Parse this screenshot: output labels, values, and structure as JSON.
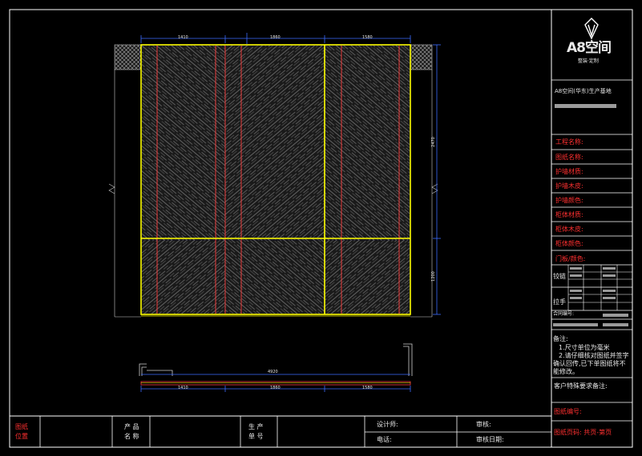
{
  "brand": {
    "name": "A8空间",
    "tagline": "整装·定制"
  },
  "sheet_title": "A8空间(华东)生产基地",
  "fields": [
    "工程名称:",
    "图纸名称:",
    "护墙材质:",
    "护墙木皮:",
    "护墙颜色:",
    "柜体材质:",
    "柜体木皮:",
    "柜体颜色:",
    "门板/颜色:"
  ],
  "hardware": {
    "hinge": "铰链",
    "handle": "拉手"
  },
  "contract_label": "合同编号:",
  "notes": {
    "title": "备注:",
    "line1": "1.尺寸单位为毫米",
    "line2": "2.请仔细核对图纸并签字",
    "line3": "确认回传,已下单图纸将不",
    "line4": "能修改。"
  },
  "customer_note": "客户特殊要求备注:",
  "drawing_no": "图纸编号:",
  "page_no": "图纸页码: 共页-第页",
  "bottom": {
    "position_l1": "图纸",
    "position_l2": "位置",
    "product_l1": "产 品",
    "product_l2": "名 称",
    "order_l1": "生 产",
    "order_l2": "单 号",
    "designer": "设计师:",
    "phone": "电话:",
    "review": "审核:",
    "review_date": "审核日期:"
  },
  "dims": {
    "top": [
      "1410",
      "1860",
      "1580"
    ],
    "right": [
      "2470",
      "1200"
    ],
    "plan_width": "4920"
  }
}
